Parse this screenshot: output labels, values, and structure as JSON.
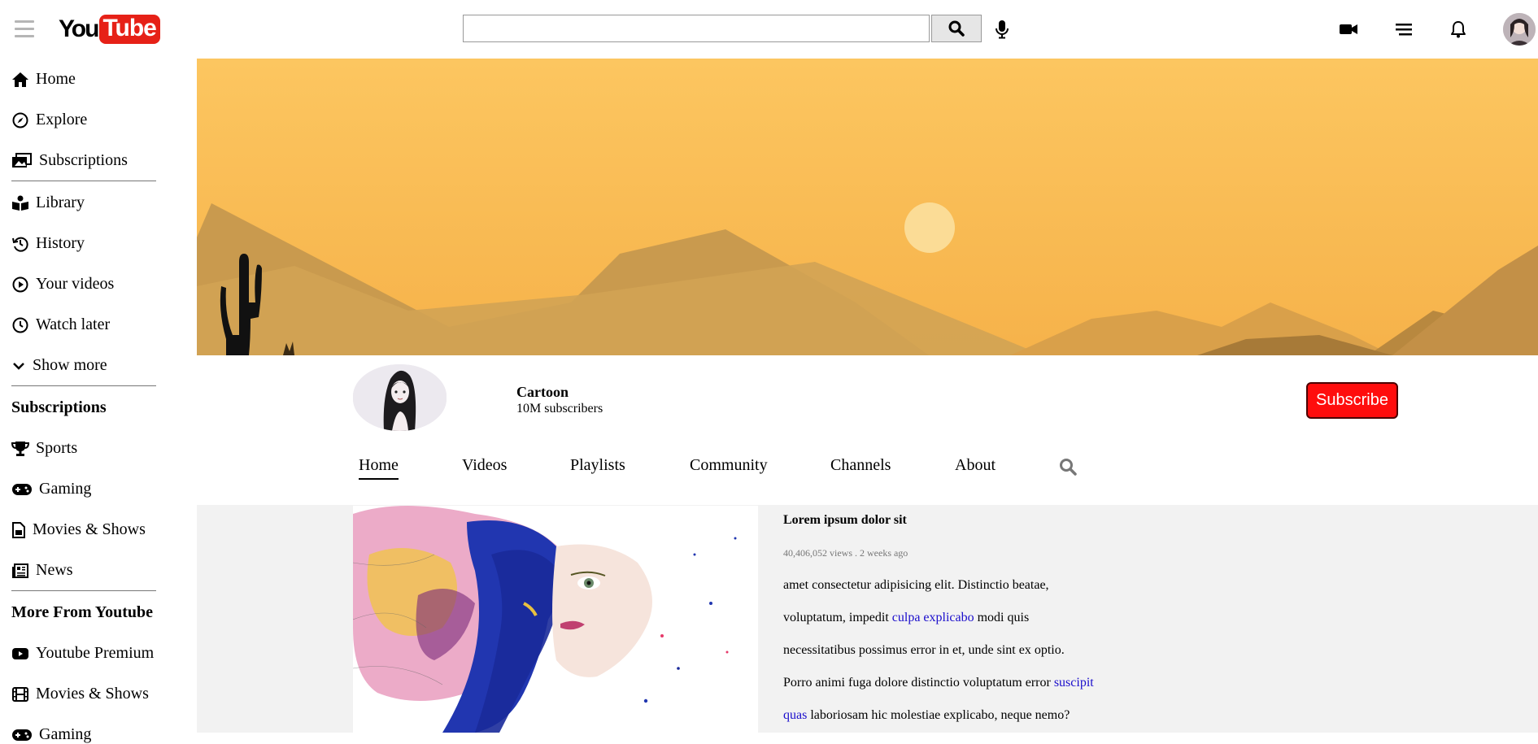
{
  "header": {
    "logo_you": "You",
    "logo_tube": "Tube",
    "search_placeholder": ""
  },
  "sidebar": {
    "main": [
      {
        "label": "Home",
        "icon": "home-icon"
      },
      {
        "label": "Explore",
        "icon": "compass-icon"
      },
      {
        "label": "Subscriptions",
        "icon": "subscriptions-icon"
      }
    ],
    "library": [
      {
        "label": "Library",
        "icon": "library-icon"
      },
      {
        "label": "History",
        "icon": "history-icon"
      },
      {
        "label": "Your videos",
        "icon": "play-circle-icon"
      },
      {
        "label": "Watch later",
        "icon": "clock-icon"
      },
      {
        "label": "Show more",
        "icon": "chevron-down-icon"
      }
    ],
    "subscriptions_heading": "Subscriptions",
    "subscriptions": [
      {
        "label": "Sports",
        "icon": "trophy-icon"
      },
      {
        "label": "Gaming",
        "icon": "gamepad-icon"
      },
      {
        "label": "Movies & Shows",
        "icon": "file-icon"
      },
      {
        "label": "News",
        "icon": "newspaper-icon"
      }
    ],
    "more_heading": "More From Youtube",
    "more": [
      {
        "label": "Youtube Premium",
        "icon": "youtube-icon"
      },
      {
        "label": "Movies & Shows",
        "icon": "film-icon"
      },
      {
        "label": "Gaming",
        "icon": "gamepad-icon"
      }
    ]
  },
  "channel": {
    "name": "Cartoon",
    "subscribers": "10M subscribers",
    "subscribe_label": "Subscribe",
    "tabs": [
      "Home",
      "Videos",
      "Playlists",
      "Community",
      "Channels",
      "About"
    ]
  },
  "video": {
    "title": "Lorem ipsum dolor sit",
    "meta": "40,406,052 views . 2 weeks ago",
    "line1": "amet consectetur adipisicing elit. Distinctio beatae,",
    "line2_before": "voluptatum, impedit ",
    "line2_link": "culpa explicabo",
    "line2_after": " modi quis",
    "line3": "necessitatibus possimus error in et, unde sint ex optio.",
    "line4_before": "Porro animi fuga dolore distinctio voluptatum error ",
    "line4_link": "suscipit",
    "line5_link": "quas",
    "line5_after": " laboriosam hic molestiae explicabo, neque nemo?"
  },
  "colors": {
    "subscribe_bg": "#ff0d0d",
    "link": "#1a0dcc",
    "banner_sky": "#fcc660",
    "content_bg": "#f2f2f2"
  }
}
